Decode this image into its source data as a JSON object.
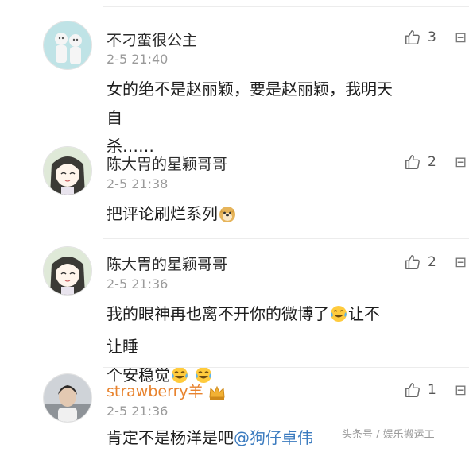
{
  "comments": [
    {
      "username": "不刁蛮很公主",
      "time": "2-5 21:40",
      "text_line1": "女的绝不是赵丽颖，要是赵丽颖，我明天自",
      "text_line2": "杀……",
      "likes": "3",
      "avatar_icon": "couple-figures-avatar"
    },
    {
      "username": "陈大胃的星颖哥哥",
      "time": "2-5 21:38",
      "text": "把评论刷烂系列",
      "likes": "2",
      "avatar_icon": "anime-girl-avatar",
      "emoji_icon": "doge-emoji-icon"
    },
    {
      "username": "陈大胃的星颖哥哥",
      "time": "2-5 21:36",
      "text_part1": "我的眼神再也离不开你的微博了",
      "text_part2": "让不让睡",
      "text_line2": "个安稳觉",
      "likes": "2",
      "avatar_icon": "anime-girl-avatar",
      "emoji_icon": "tears-of-joy-emoji-icon"
    },
    {
      "username": "strawberry羊",
      "time": "2-5 21:36",
      "text_start": "肯定不是杨洋是吧",
      "mention": "@狗仔卓伟",
      "likes": "1",
      "avatar_icon": "person-photo-avatar",
      "badge_icon": "crown-badge-icon"
    }
  ],
  "more_icon": "more-icon",
  "watermark": "头条号 / 娱乐搬运工",
  "colors": {
    "orange_name": "#e8832e",
    "mention": "#3b7bbf",
    "time": "#9a9a9a"
  }
}
